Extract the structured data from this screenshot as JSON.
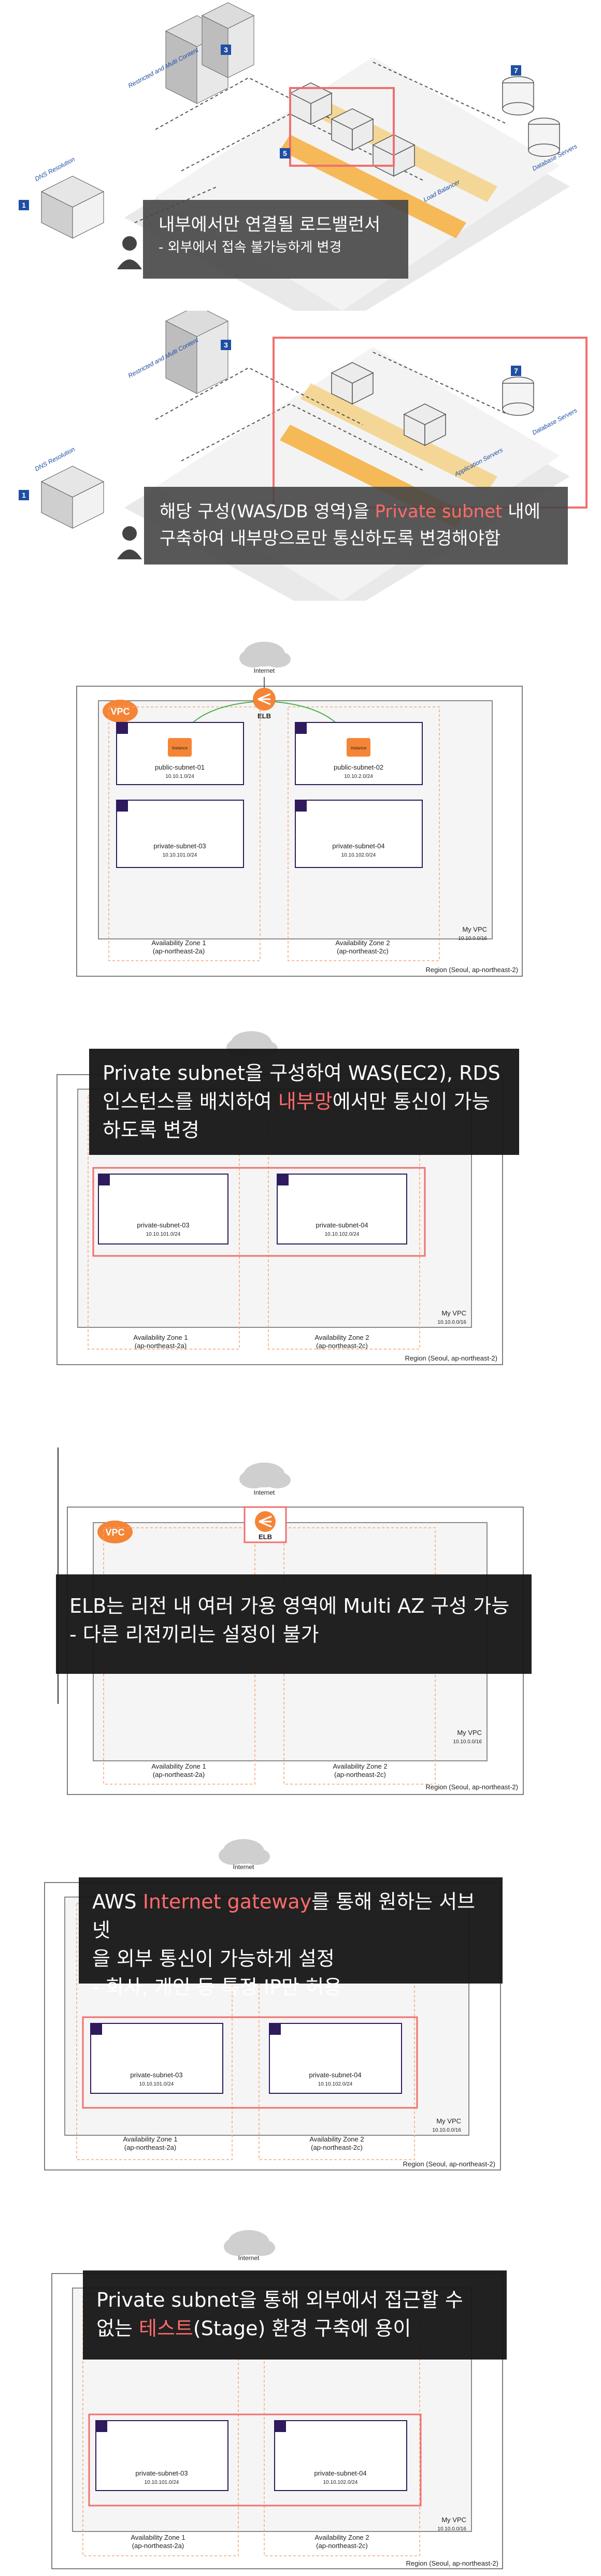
{
  "iso1": {
    "labels": {
      "restricted": "Restricted and Multi Content",
      "dns": "DNS Resolution",
      "load_balancer": "Load Balancer",
      "db_server": "Database Servers",
      "app_server": "Application Servers"
    },
    "badges": [
      "1",
      "2",
      "3",
      "4",
      "5",
      "6",
      "7"
    ],
    "caption_title": "내부에서만 연결될 로드밸런서",
    "caption_sub": "- 외부에서 접속 불가능하게 변경"
  },
  "iso2": {
    "caption_pre": "해당 구성(WAS/DB 영역)을 ",
    "caption_hl": "Private subnet",
    "caption_post": " 내에",
    "caption_line2": "구축하여 내부망으로만 통신하도록 변경해야함"
  },
  "vpc": {
    "internet": "Internet",
    "elb": "ELB",
    "vpc_badge": "VPC",
    "instance": "Instance",
    "public1_name": "public-subnet-01",
    "public1_cidr": "10.10.1.0/24",
    "public2_name": "public-subnet-02",
    "public2_cidr": "10.10.2.0/24",
    "private3_name": "private-subnet-03",
    "private3_cidr": "10.10.101.0/24",
    "private4_name": "private-subnet-04",
    "private4_cidr": "10.10.102.0/24",
    "my_vpc": "My VPC",
    "vpc_cidr": "10.10.0.0/16",
    "az1": "Availability Zone 1",
    "az1_id": "(ap-northeast-2a)",
    "az2": "Availability Zone 2",
    "az2_id": "(ap-northeast-2c)",
    "region": "Region (Seoul, ap-northeast-2)"
  },
  "overlays": {
    "o1_line1": "Private subnet을 구성하여 WAS(EC2), RDS",
    "o1_line2_pre": "인스턴스를 배치하여 ",
    "o1_line2_hl": "내부망",
    "o1_line2_post": "에서만 통신이 가능",
    "o1_line3": "하도록 변경",
    "o2_line1": "ELB는 리전 내 여러 가용 영역에 Multi AZ 구성 가능",
    "o2_line2": "- 다른 리전끼리는 설정이 불가",
    "o3_line1_pre": "AWS ",
    "o3_line1_hl": "Internet gateway",
    "o3_line1_post": "를 통해 원하는 서브넷",
    "o3_line2": "을 외부 통신이 가능하게 설정",
    "o3_line3": "- 회사, 개인 등 특정 IP만 허용",
    "o4_line1": "Private subnet을 통해 외부에서 접근할 수",
    "o4_line2_pre": "없는 ",
    "o4_line2_hl": "테스트",
    "o4_line2_post": "(Stage) 환경 구축에 용이"
  },
  "colors": {
    "accent_red": "#ff6b6b",
    "aws_orange": "#f58536",
    "subnet_purple": "#2e1a5c",
    "highlight_box": "#f07070"
  }
}
